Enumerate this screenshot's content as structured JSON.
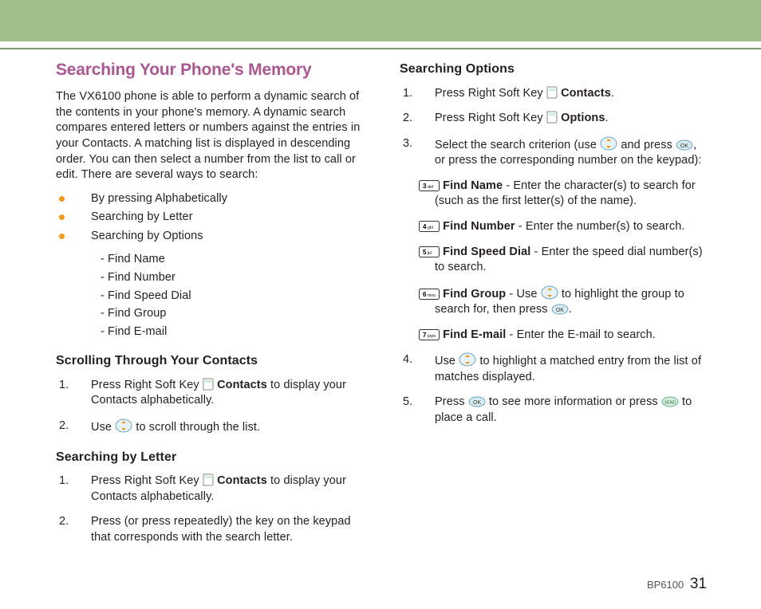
{
  "page": {
    "model": "BP6100",
    "num": "31"
  },
  "left": {
    "title": "Searching Your Phone's Memory",
    "intro": "The VX6100 phone is able to perform a dynamic search of the contents in your phone's memory. A dynamic search compares entered letters or numbers against the entries in your Contacts. A matching list is displayed in descending order. You can then select a number from the list to call or edit. There are several ways to search:",
    "bullets": [
      "By pressing Alphabetically",
      "Searching by Letter",
      "Searching by Options"
    ],
    "subfinds": [
      "- Find Name",
      "- Find Number",
      "- Find Speed Dial",
      "- Find Group",
      "- Find E-mail"
    ],
    "h_scroll": "Scrolling Through Your Contacts",
    "scroll_1a": "Press Right Soft Key ",
    "scroll_contacts": "Contacts",
    "scroll_1b": " to display your Contacts alphabetically.",
    "scroll_2a": "Use ",
    "scroll_2b": " to scroll through the list.",
    "h_letter": "Searching by Letter",
    "letter_1a": "Press Right Soft Key ",
    "letter_contacts": "Contacts",
    "letter_1b": " to display your Contacts alphabetically.",
    "letter_2": "Press (or press repeatedly) the key on the keypad that corresponds with the search letter."
  },
  "right": {
    "h_options": "Searching Options",
    "o1a": "Press Right Soft Key ",
    "o1_contacts": "Contacts",
    "o1b": ".",
    "o2a": "Press Right Soft Key ",
    "o2_options": "Options",
    "o2b": ".",
    "o3a": "Select the search criterion (use ",
    "o3b": " and press ",
    "o3c": ", or press the corresponding number on the keypad):",
    "k3": "3 def",
    "k3_t": "Find Name",
    "k3_d": " - Enter the character(s) to search for (such as the first letter(s) of the name).",
    "k4": "4 ghi",
    "k4_t": "Find Number",
    "k4_d": " - Enter the number(s) to search.",
    "k5": "5 jkl",
    "k5_t": "Find Speed Dial",
    "k5_d": " - Enter the speed dial number(s) to search.",
    "k6": "6 mno",
    "k6_t": "Find Group",
    "k6_d1": " - Use ",
    "k6_d2": " to highlight the group to search for, then press ",
    "k6_d3": ".",
    "k7": "7 pqrs",
    "k7_t": "Find E-mail",
    "k7_d": " - Enter the E-mail to search.",
    "o4a": "Use ",
    "o4b": " to highlight a matched entry from the list of matches displayed.",
    "o5a": "Press ",
    "o5b": " to see more information or press ",
    "o5c": " to place a call."
  }
}
